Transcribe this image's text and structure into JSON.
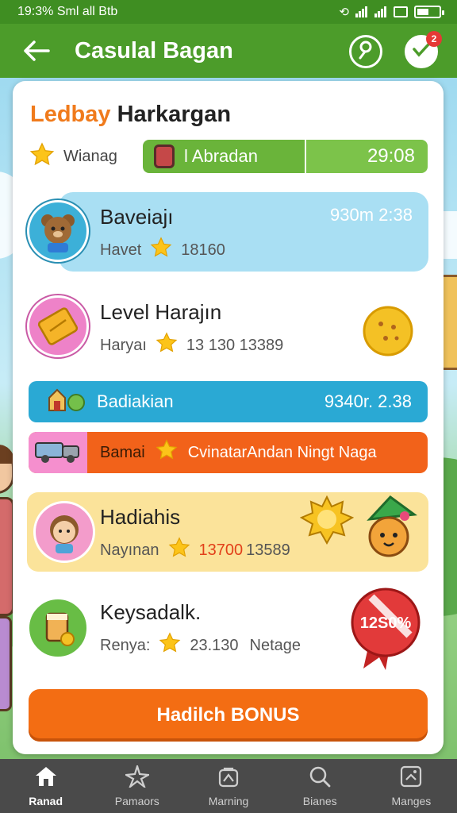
{
  "status_bar": {
    "time_text": "19:3% Sml  all Btb",
    "battery_icon": "battery-icon",
    "colors": {
      "bar": "#3f8e22"
    }
  },
  "app_bar": {
    "title": "Casulal Bagan",
    "notification_count": "2"
  },
  "card": {
    "title_brand": "Ledbay",
    "title_rest": "Harkargan",
    "sub_row": {
      "label": "Wianag",
      "pill_label": "l Abradan",
      "pill_time": "29:08"
    },
    "entries": [
      {
        "name": "Baveiajı",
        "label": "Havet",
        "value": "18160",
        "time": "930m 2:38"
      },
      {
        "name": "Level Harajın",
        "label": "Haryaı",
        "value": "13 130  13389"
      },
      {
        "name": "Hadiahis",
        "label": "Nayınan",
        "value": "13700",
        "value2": "13589"
      },
      {
        "name": "Keysadalk.",
        "label": "Renya:",
        "value": "23.130",
        "extra": "Netage",
        "badge": "12S0%"
      }
    ],
    "banner_blue": {
      "label": "Badiakian",
      "time": "9340r. 2.38"
    },
    "banner_orange": {
      "label": "Bamai",
      "text": "CvinatarAndan Ningt Naga"
    },
    "cta_label": "Hadilch BONUS"
  },
  "bottom_nav": [
    {
      "label": "Ranad",
      "icon": "home-icon",
      "active": true
    },
    {
      "label": "Pamaors",
      "icon": "sparkle-icon",
      "active": false
    },
    {
      "label": "Marning",
      "icon": "lock-box-icon",
      "active": false
    },
    {
      "label": "Bianes",
      "icon": "search-icon",
      "active": false
    },
    {
      "label": "Manges",
      "icon": "grid-box-icon",
      "active": false
    }
  ],
  "colors": {
    "app_bar": "#4c9c2a",
    "brand_orange": "#f07b1c",
    "green_pill": "#6ab43a",
    "banner_blue": "#2aa9d4",
    "banner_orange": "#f2621a",
    "highlight_blue": "#a9dff3",
    "highlight_yellow": "#fbe39a",
    "cta": "#f36d13",
    "nav": "#4a4a4a"
  }
}
